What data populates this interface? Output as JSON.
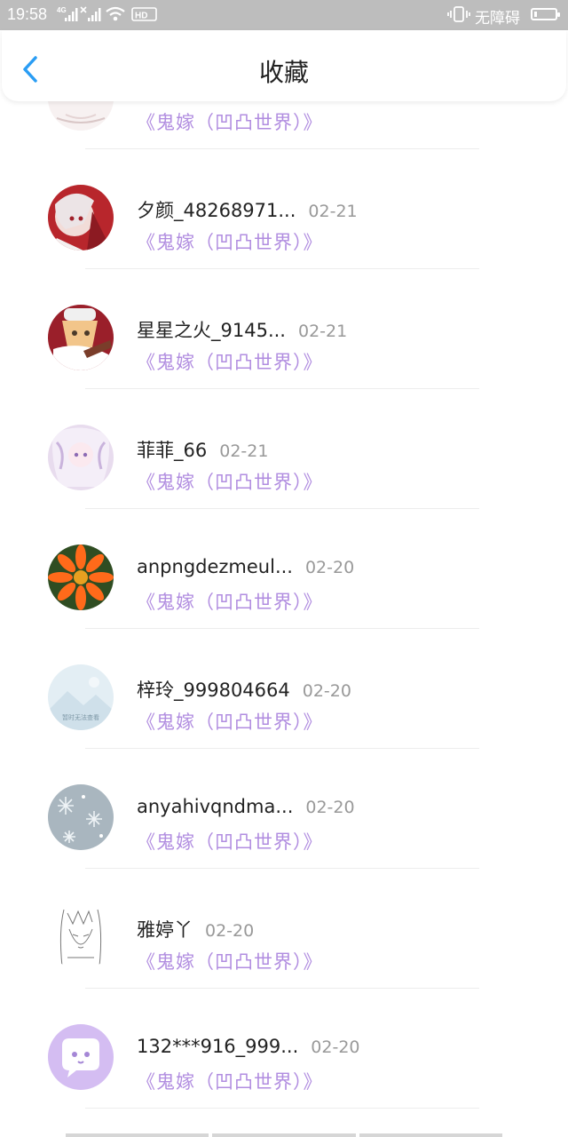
{
  "status_bar": {
    "time": "19:58",
    "network_1": "4G",
    "network_2": "HD",
    "accessibility": "无障碍",
    "battery_level": 0.15
  },
  "header": {
    "title": "收藏"
  },
  "work_title": "《鬼嫁（凹凸世界）》",
  "items": [
    {
      "name": "",
      "date": "",
      "work": "《鬼嫁（凹凸世界）》",
      "avatar": "sketch-light"
    },
    {
      "name": "夕颜_48268971...",
      "date": "02-21",
      "work": "《鬼嫁（凹凸世界）》",
      "avatar": "anime-red"
    },
    {
      "name": "星星之火_9145...",
      "date": "02-21",
      "work": "《鬼嫁（凹凸世界）》",
      "avatar": "anime-cap"
    },
    {
      "name": "菲菲_66",
      "date": "02-21",
      "work": "《鬼嫁（凹凸世界）》",
      "avatar": "anime-white"
    },
    {
      "name": "anpngdezmeul...",
      "date": "02-20",
      "work": "《鬼嫁（凹凸世界）》",
      "avatar": "flower"
    },
    {
      "name": "梓玲_999804664",
      "date": "02-20",
      "work": "《鬼嫁（凹凸世界）》",
      "avatar": "placeholder",
      "placeholder_text": "暂时无法查看"
    },
    {
      "name": "anyahivqndma...",
      "date": "02-20",
      "work": "《鬼嫁（凹凸世界）》",
      "avatar": "snow"
    },
    {
      "name": "雅婷丫",
      "date": "02-20",
      "work": "《鬼嫁（凹凸世界）》",
      "avatar": "sketch"
    },
    {
      "name": "132***916_999...",
      "date": "02-20",
      "work": "《鬼嫁（凹凸世界）》",
      "avatar": "default-purple"
    }
  ]
}
